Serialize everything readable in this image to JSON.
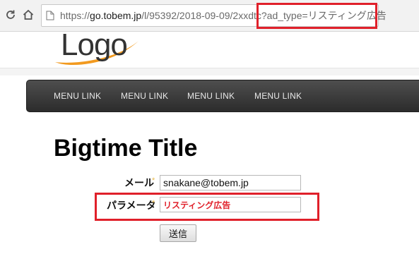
{
  "browser": {
    "url_prefix": "https://",
    "url_host": "go.tobem.jp",
    "url_path": "/l/95392/2018-09-09/2xxdtc",
    "url_query": "?ad_type=リスティング広告"
  },
  "site": {
    "logo_text": "Logo",
    "nav_links": [
      "MENU LINK",
      "MENU LINK",
      "MENU LINK",
      "MENU LINK"
    ]
  },
  "form": {
    "title": "Bigtime Title",
    "required_mark": "*",
    "email_label": "メール",
    "email_value": "snakane@tobem.jp",
    "param_label": "パラメータ",
    "param_value": "リスティング広告",
    "submit_label": "送信"
  },
  "colors": {
    "highlight": "#e0202a",
    "navbar": "#3a3a3a",
    "required": "#e8b84a"
  }
}
